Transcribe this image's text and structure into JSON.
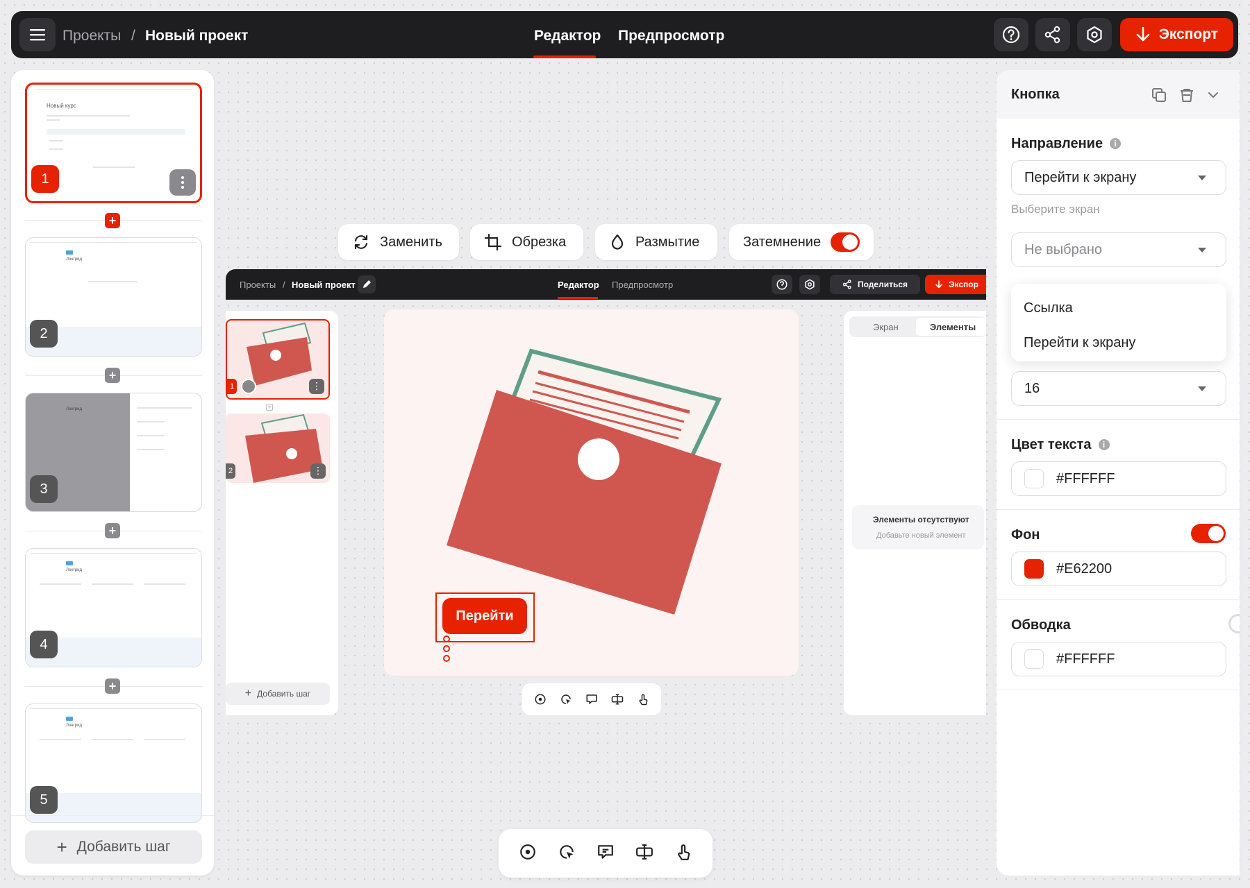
{
  "topbar": {
    "breadcrumb_root": "Проекты",
    "breadcrumb_sep": "/",
    "breadcrumb_current": "Новый проект",
    "tab_editor": "Редактор",
    "tab_preview": "Предпросмотр",
    "export_label": "Экспорт"
  },
  "steps": {
    "numbers": [
      "1",
      "2",
      "3",
      "4",
      "5"
    ],
    "thumb1_title": "Новый курс",
    "thumb_caption": "Лонгрид",
    "add_step": "Добавить шаг"
  },
  "image_toolbar": {
    "replace": "Заменить",
    "crop": "Обрезка",
    "blur": "Размытие",
    "dim": "Затемнение",
    "dim_enabled": true
  },
  "preview": {
    "breadcrumb_root": "Проекты",
    "breadcrumb_sep": "/",
    "breadcrumb_current": "Новый проект",
    "tab_editor": "Редактор",
    "tab_preview": "Предпросмотр",
    "share_label": "Поделиться",
    "export_label": "Экспор",
    "step_numbers": [
      "1",
      "2"
    ],
    "add_step": "Добавить шаг",
    "cta_button": "Перейти",
    "panel_tab_screen": "Экран",
    "panel_tab_elements": "Элементы",
    "empty_title": "Элементы отсутствуют",
    "empty_hint": "Добавьте новый элемент"
  },
  "properties": {
    "title": "Кнопка",
    "direction_label": "Направление",
    "direction_value": "Перейти к экрану",
    "screen_label": "Выберите экран",
    "screen_value": "Не выбрано",
    "dropdown_options": [
      "Ссылка",
      "Перейти к экрану"
    ],
    "font_size_value": "16",
    "text_color_label": "Цвет текста",
    "text_color_value": "#FFFFFF",
    "background_label": "Фон",
    "background_value": "#E62200",
    "background_enabled": true,
    "border_label": "Обводка",
    "border_value": "#FFFFFF",
    "border_enabled": false
  },
  "colors": {
    "accent": "#E62200",
    "topbar_bg": "#1E1E21",
    "illustration_red": "#D0574F",
    "illustration_green": "#5E9E88"
  },
  "icons": [
    "menu-icon",
    "help-icon",
    "share-icon",
    "settings-icon",
    "download-icon",
    "replace-icon",
    "crop-icon",
    "blur-icon",
    "copy-icon",
    "trash-icon",
    "chevron-down-icon",
    "hotspot-icon",
    "click-icon",
    "tooltip-icon",
    "input-icon",
    "drag-icon",
    "edit-icon",
    "plus-icon"
  ]
}
